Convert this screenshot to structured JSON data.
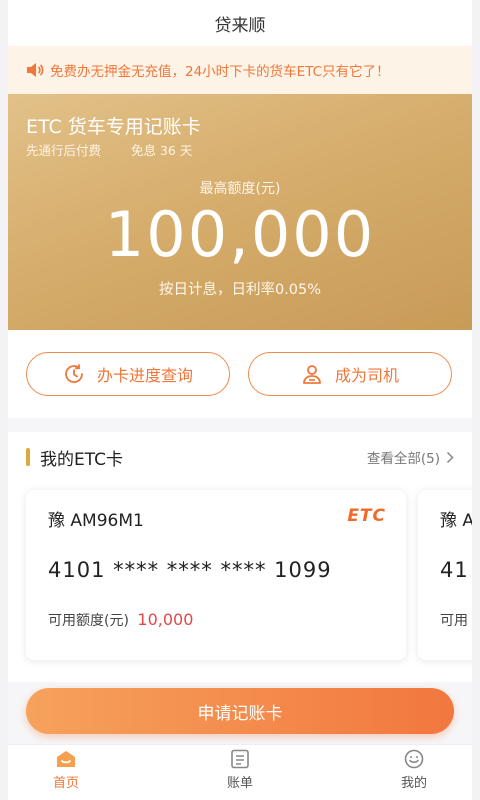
{
  "header": {
    "title": "贷来顺"
  },
  "notice": {
    "text": "免费办无押金无充值，24小时下卡的货车ETC只有它了！"
  },
  "promo": {
    "title": "ETC 货车专用记账卡",
    "sub_left": "先通行后付费",
    "sub_right": "免息 36 天",
    "limit_label": "最高额度(元)",
    "limit_value": "100,000",
    "rate_text": "按日计息，日利率0.05%"
  },
  "actions": {
    "progress_label": "办卡进度查询",
    "driver_label": "成为司机"
  },
  "etc_section": {
    "title": "我的ETC卡",
    "view_all": "查看全部(5)",
    "cards": [
      {
        "plate": "豫 AM96M1",
        "logo": "ETC",
        "number": "4101 **** **** **** 1099",
        "avail_label": "可用额度(元)",
        "avail_amount": "10,000"
      },
      {
        "plate": "豫 A",
        "number": "41",
        "avail_label": "可用"
      }
    ]
  },
  "apply_button": {
    "label": "申请记账卡"
  },
  "tabbar": {
    "home": "首页",
    "bills": "账单",
    "mine": "我的"
  },
  "colors": {
    "accent": "#f0773a",
    "gold": "#d6ad6c",
    "amount": "#e3474a"
  }
}
